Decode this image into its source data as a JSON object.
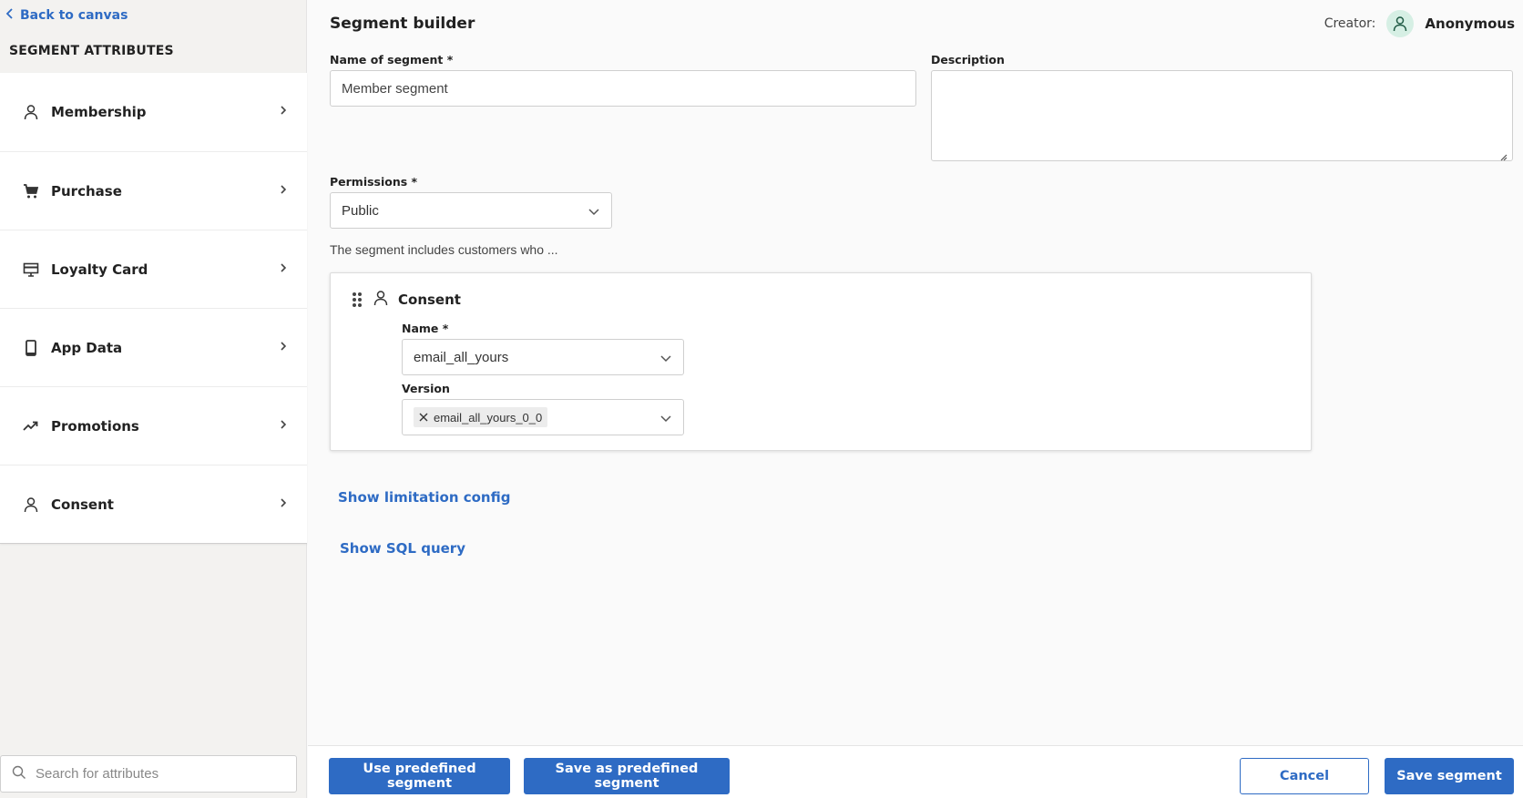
{
  "sidebar": {
    "back_label": "Back to canvas",
    "title": "SEGMENT ATTRIBUTES",
    "items": [
      {
        "label": "Membership",
        "icon": "person-icon"
      },
      {
        "label": "Purchase",
        "icon": "cart-icon"
      },
      {
        "label": "Loyalty Card",
        "icon": "card-icon"
      },
      {
        "label": "App Data",
        "icon": "phone-icon"
      },
      {
        "label": "Promotions",
        "icon": "trend-icon"
      },
      {
        "label": "Consent",
        "icon": "person-icon"
      }
    ],
    "search_placeholder": "Search for attributes"
  },
  "header": {
    "title": "Segment builder",
    "creator_label": "Creator:",
    "creator_name": "Anonymous"
  },
  "form": {
    "name_label": "Name of segment *",
    "name_value": "Member segment",
    "description_label": "Description",
    "description_value": "",
    "permissions_label": "Permissions *",
    "permissions_value": "Public",
    "includes_text": "The segment includes customers who ..."
  },
  "condition": {
    "title": "Consent",
    "name_label": "Name *",
    "name_value": "email_all_yours",
    "version_label": "Version",
    "version_chip": "email_all_yours_0_0"
  },
  "links": {
    "limitation": "Show limitation config",
    "sql": "Show SQL query"
  },
  "footer": {
    "use_predefined": "Use predefined segment",
    "save_as_predefined": "Save as predefined segment",
    "cancel": "Cancel",
    "save": "Save segment"
  },
  "colors": {
    "accent": "#2e6bc4",
    "avatar_bg": "#d6efe4"
  }
}
